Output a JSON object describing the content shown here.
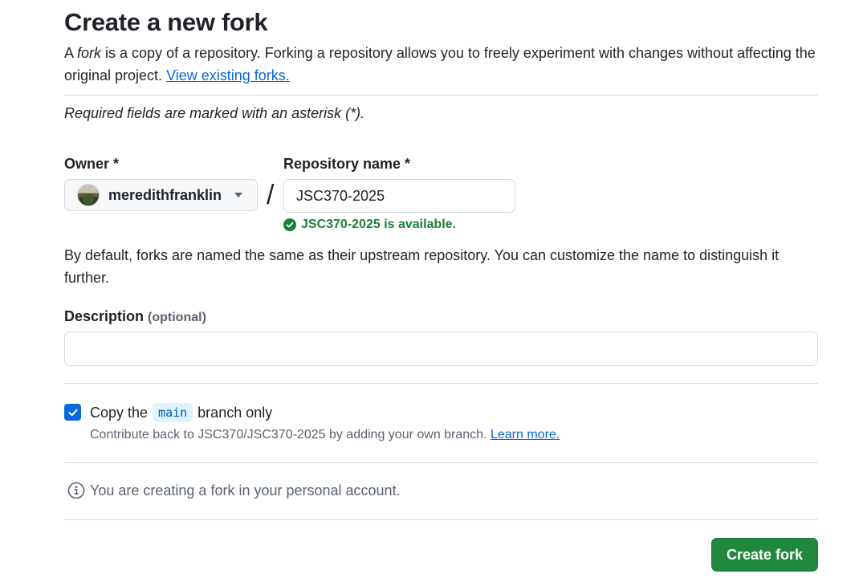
{
  "header": {
    "title": "Create a new fork"
  },
  "intro": {
    "part1": "A ",
    "fork_word": "fork",
    "part2": " is a copy of a repository. Forking a repository allows you to freely experiment with changes without affecting the original project. ",
    "link": "View existing forks."
  },
  "required_note": "Required fields are marked with an asterisk (*).",
  "owner": {
    "label": "Owner *",
    "value": "meredithfranklin"
  },
  "repo": {
    "label": "Repository name *",
    "value": "JSC370-2025",
    "availability": "JSC370-2025 is available."
  },
  "naming_help": "By default, forks are named the same as their upstream repository. You can customize the name to distinguish it further.",
  "description": {
    "label": "Description",
    "optional": "(optional)",
    "value": ""
  },
  "copy_branch": {
    "checked": true,
    "prefix": "Copy the",
    "branch": "main",
    "suffix": "branch only",
    "help": "Contribute back to JSC370/JSC370-2025 by adding your own branch.",
    "help_link": "Learn more."
  },
  "info_text": "You are creating a fork in your personal account.",
  "create_button": "Create fork",
  "colors": {
    "primary": "#1f883d",
    "link": "#0969da",
    "success": "#1a7f37"
  }
}
